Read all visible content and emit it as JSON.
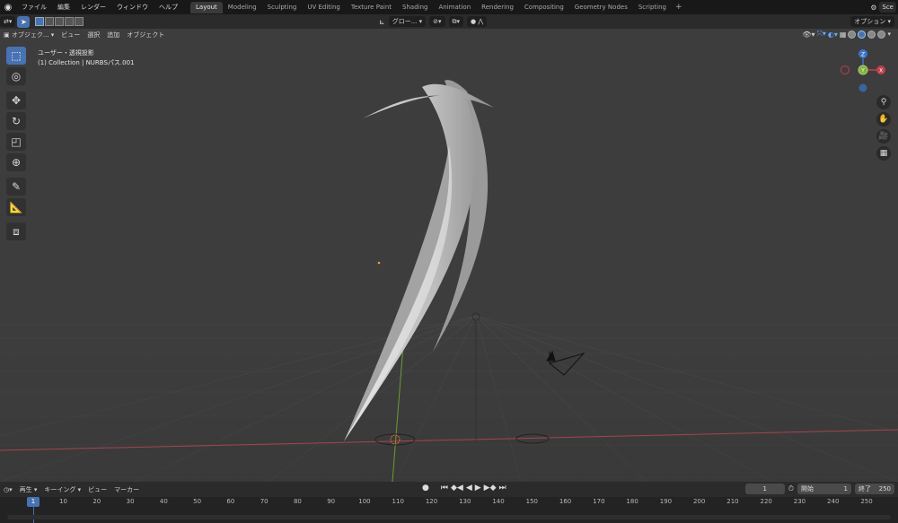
{
  "menu": {
    "items": [
      "ファイル",
      "編集",
      "レンダー",
      "ウィンドウ",
      "ヘルプ"
    ]
  },
  "workspaces": [
    "Layout",
    "Modeling",
    "Sculpting",
    "UV Editing",
    "Texture Paint",
    "Shading",
    "Animation",
    "Rendering",
    "Compositing",
    "Geometry Nodes",
    "Scripting"
  ],
  "active_workspace": "Layout",
  "scene_label": "Sce",
  "header": {
    "mode": "オブジェク...",
    "menus": [
      "ビュー",
      "選択",
      "追加",
      "オブジェクト"
    ],
    "transform_orientation": "グロー...",
    "options": "オプション"
  },
  "viewport": {
    "view_title": "ユーザー・透視投影",
    "collection_info": "(1) Collection | NURBSパス.001",
    "axis_labels": {
      "x": "X",
      "y": "Y",
      "z": "Z"
    }
  },
  "timeline": {
    "menus": [
      "再生",
      "キーイング",
      "ビュー",
      "マーカー"
    ],
    "current_frame": "1",
    "start_label": "開始",
    "start_value": "1",
    "end_label": "終了",
    "end_value": "250",
    "ruler_ticks": [
      "1",
      "10",
      "20",
      "30",
      "40",
      "50",
      "60",
      "70",
      "80",
      "90",
      "100",
      "110",
      "120",
      "130",
      "140",
      "150",
      "160",
      "170",
      "180",
      "190",
      "200",
      "210",
      "220",
      "230",
      "240",
      "250"
    ]
  },
  "colors": {
    "accent": "#4772b3",
    "viewport_bg": "#3d3d3d",
    "x_axis": "#c0404b",
    "y_axis": "#7fb23a",
    "z_axis": "#3b74c9"
  }
}
